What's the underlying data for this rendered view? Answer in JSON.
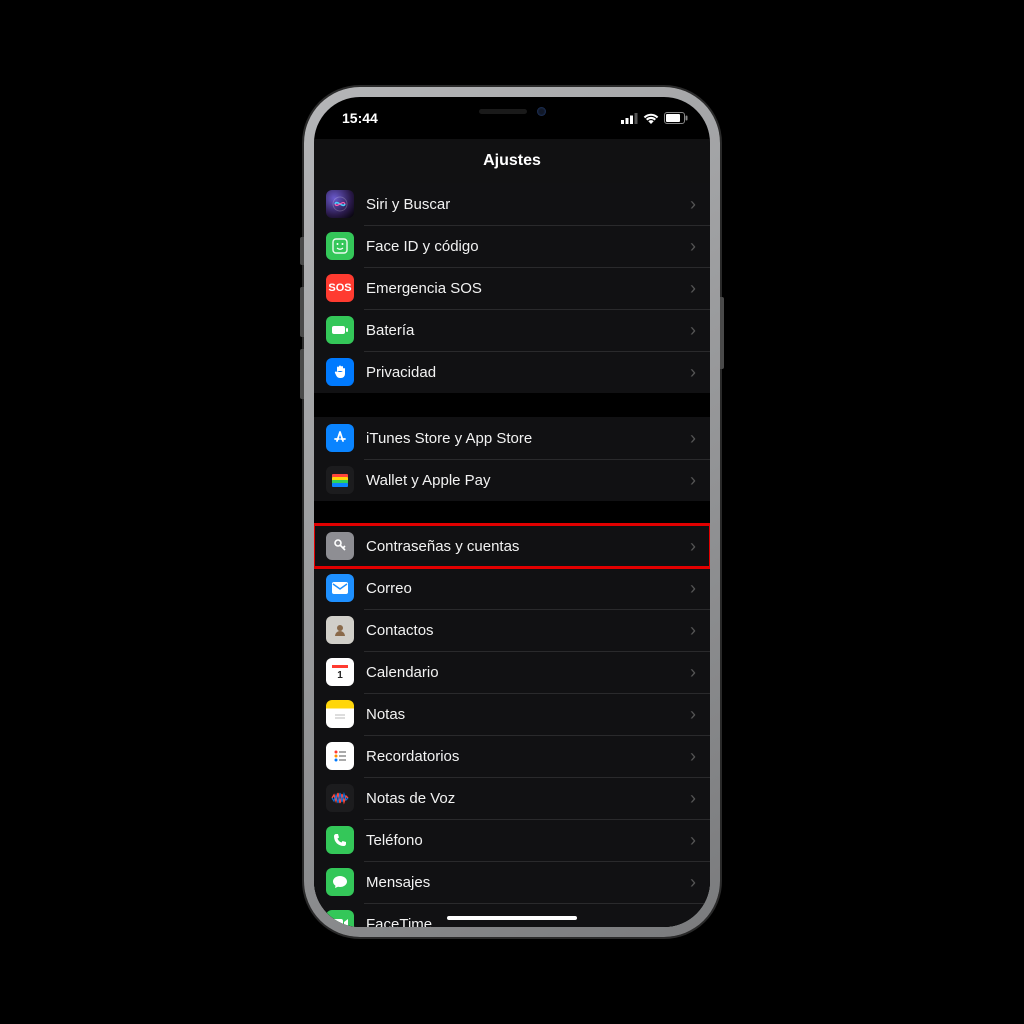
{
  "status_bar": {
    "time": "15:44"
  },
  "header": {
    "title": "Ajustes"
  },
  "groups": [
    {
      "rows": [
        {
          "id": "siri",
          "label": "Siri y Buscar",
          "icon": "siri-icon"
        },
        {
          "id": "faceid",
          "label": "Face ID y código",
          "icon": "faceid-icon"
        },
        {
          "id": "sos",
          "label": "Emergencia SOS",
          "icon": "sos-icon"
        },
        {
          "id": "battery",
          "label": "Batería",
          "icon": "battery-icon"
        },
        {
          "id": "privacy",
          "label": "Privacidad",
          "icon": "privacy-icon"
        }
      ]
    },
    {
      "rows": [
        {
          "id": "appstore",
          "label": "iTunes Store y App Store",
          "icon": "appstore-icon"
        },
        {
          "id": "wallet",
          "label": "Wallet y Apple Pay",
          "icon": "wallet-icon"
        }
      ]
    },
    {
      "rows": [
        {
          "id": "passwords",
          "label": "Contraseñas y cuentas",
          "icon": "key-icon",
          "highlighted": true
        },
        {
          "id": "mail",
          "label": "Correo",
          "icon": "mail-icon"
        },
        {
          "id": "contacts",
          "label": "Contactos",
          "icon": "contacts-icon"
        },
        {
          "id": "calendar",
          "label": "Calendario",
          "icon": "calendar-icon"
        },
        {
          "id": "notes",
          "label": "Notas",
          "icon": "notes-icon"
        },
        {
          "id": "reminders",
          "label": "Recordatorios",
          "icon": "reminders-icon"
        },
        {
          "id": "voicememos",
          "label": "Notas de Voz",
          "icon": "voicememos-icon"
        },
        {
          "id": "phone",
          "label": "Teléfono",
          "icon": "phone-icon"
        },
        {
          "id": "messages",
          "label": "Mensajes",
          "icon": "messages-icon"
        },
        {
          "id": "facetime",
          "label": "FaceTime",
          "icon": "facetime-icon"
        }
      ]
    }
  ],
  "sos_text": "SOS"
}
